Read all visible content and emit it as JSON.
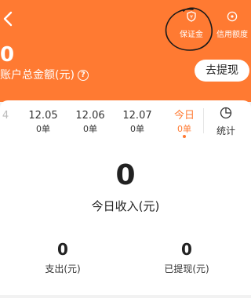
{
  "header": {
    "back_icon": "chevron-left-icon",
    "actions": [
      {
        "label": "保证金",
        "icon": "shield-icon"
      },
      {
        "label": "信用额度",
        "icon": "credit-circle-icon"
      }
    ],
    "balance_value": "0",
    "balance_label": "账户总金额(元)",
    "help_symbol": "?",
    "withdraw_label": "去提现"
  },
  "dates": [
    {
      "date": "4",
      "count": ""
    },
    {
      "date": "12.05",
      "count": "0单"
    },
    {
      "date": "12.06",
      "count": "0单"
    },
    {
      "date": "12.07",
      "count": "0单"
    },
    {
      "date": "今日",
      "count": "0单"
    }
  ],
  "stats_button": {
    "label": "统计",
    "icon": "pie-chart-icon"
  },
  "today_income": {
    "value": "0",
    "label": "今日收入(元)"
  },
  "expense": {
    "value": "0",
    "label": "支出(元)"
  },
  "withdrawn": {
    "value": "0",
    "label": "已提现(元)"
  },
  "colors": {
    "accent": "#ff7a32",
    "background": "#f2f2f2"
  }
}
